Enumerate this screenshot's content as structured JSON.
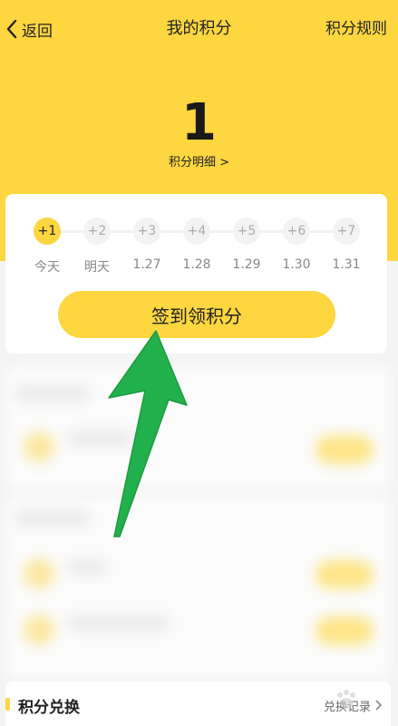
{
  "nav": {
    "back_label": "返回",
    "title": "我的积分",
    "rules_label": "积分规则"
  },
  "points": {
    "value": "1",
    "detail_label": "积分明细 >"
  },
  "signin": {
    "days": [
      {
        "bonus": "+1",
        "label": "今天",
        "active": true
      },
      {
        "bonus": "+2",
        "label": "明天",
        "active": false
      },
      {
        "bonus": "+3",
        "label": "1.27",
        "active": false
      },
      {
        "bonus": "+4",
        "label": "1.28",
        "active": false
      },
      {
        "bonus": "+5",
        "label": "1.29",
        "active": false
      },
      {
        "bonus": "+6",
        "label": "1.30",
        "active": false
      },
      {
        "bonus": "+7",
        "label": "1.31",
        "active": false
      }
    ],
    "button_label": "签到领积分"
  },
  "exchange": {
    "title": "积分兑换",
    "record_label": "兑换记录"
  },
  "colors": {
    "accent": "#fdd640",
    "arrow": "#22b04c"
  },
  "icons": [
    "chevron-left-icon",
    "chevron-right-icon",
    "pointer-arrow-icon"
  ]
}
